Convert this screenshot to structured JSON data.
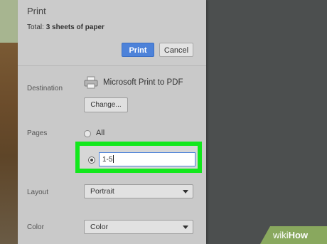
{
  "dialog": {
    "title": "Print",
    "total_prefix": "Total: ",
    "total_value": "3 sheets of paper",
    "print_button": "Print",
    "cancel_button": "Cancel"
  },
  "destination": {
    "label": "Destination",
    "printer_icon": "printer-icon",
    "printer_name": "Microsoft Print to PDF",
    "change_button": "Change..."
  },
  "pages": {
    "label": "Pages",
    "all_option": "All",
    "range_value": "1-5",
    "selected": "range",
    "highlight_color": "#12e81c"
  },
  "layout": {
    "label": "Layout",
    "selected": "Portrait"
  },
  "color": {
    "label": "Color",
    "selected": "Color"
  },
  "watermark": {
    "wiki": "wiki",
    "how": "How"
  },
  "colors": {
    "print_button": "#4d82d9",
    "panel": "#c9c9c9",
    "background": "#4c4f4f"
  }
}
